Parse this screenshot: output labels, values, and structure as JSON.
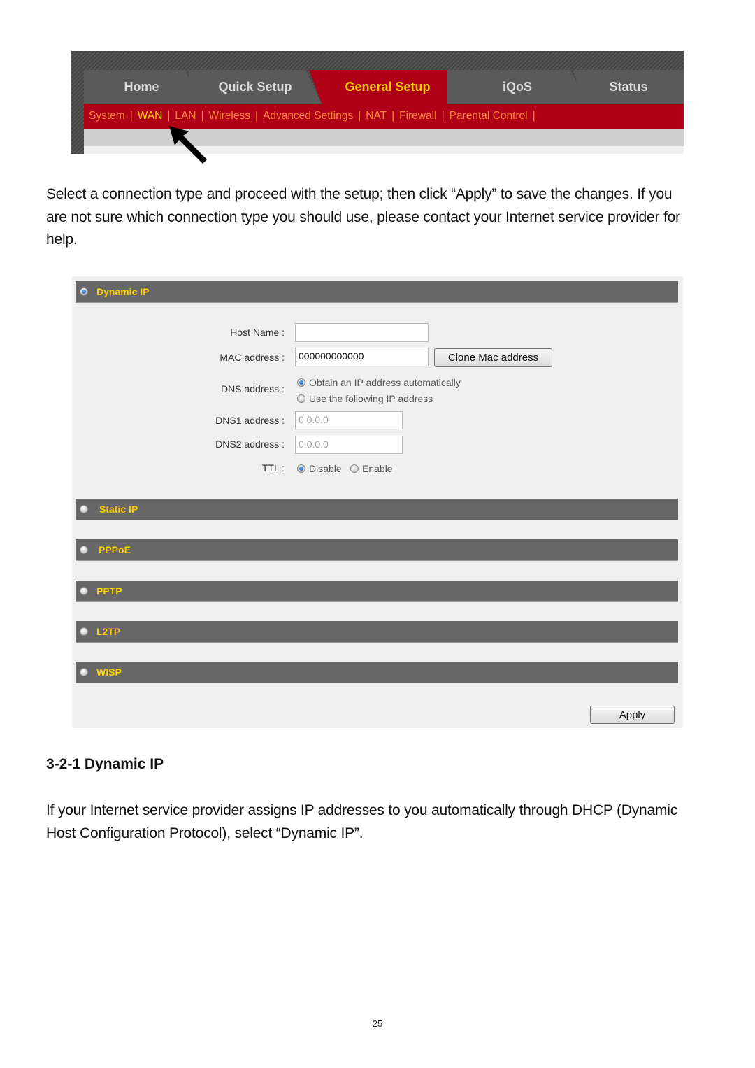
{
  "nav": {
    "tabs": [
      {
        "label": "Home",
        "active": false
      },
      {
        "label": "Quick Setup",
        "active": false
      },
      {
        "label": "General Setup",
        "active": true
      },
      {
        "label": "iQoS",
        "active": false
      },
      {
        "label": "Status",
        "active": false
      }
    ],
    "subnav": [
      {
        "label": "System",
        "active": false
      },
      {
        "label": "WAN",
        "active": true
      },
      {
        "label": "LAN",
        "active": false
      },
      {
        "label": "Wireless",
        "active": false
      },
      {
        "label": "Advanced Settings",
        "active": false
      },
      {
        "label": "NAT",
        "active": false
      },
      {
        "label": "Firewall",
        "active": false
      },
      {
        "label": "Parental Control",
        "active": false
      }
    ],
    "separator": "|",
    "annotation": "arrow pointing to WAN"
  },
  "intro_text": "Select a connection type and proceed with the setup; then click “Apply” to save the changes. If you are not sure which connection type you should use, please contact your Internet service provider for help.",
  "wan_panel": {
    "sections": [
      {
        "label": "Dynamic IP",
        "selected": true
      },
      {
        "label": "Static IP",
        "selected": false
      },
      {
        "label": "PPPoE",
        "selected": false
      },
      {
        "label": "PPTP",
        "selected": false
      },
      {
        "label": "L2TP",
        "selected": false
      },
      {
        "label": "WISP",
        "selected": false
      }
    ],
    "form": {
      "host_name_label": "Host Name :",
      "host_name_value": "",
      "mac_label": "MAC address :",
      "mac_value": "000000000000",
      "clone_button": "Clone Mac address",
      "dns_label": "DNS address :",
      "dns_options": [
        {
          "label": "Obtain an IP address automatically",
          "selected": true
        },
        {
          "label": "Use the following IP address",
          "selected": false
        }
      ],
      "dns1_label": "DNS1 address :",
      "dns1_value": "0.0.0.0",
      "dns2_label": "DNS2 address :",
      "dns2_value": "0.0.0.0",
      "ttl_label": "TTL :",
      "ttl_options": [
        {
          "label": "Disable",
          "selected": true
        },
        {
          "label": "Enable",
          "selected": false
        }
      ]
    },
    "apply_button": "Apply"
  },
  "section_heading": "3-2-1 Dynamic IP",
  "body_text": "If your Internet service provider assigns IP addresses to you automatically through DHCP (Dynamic Host Configuration Protocol), select “Dynamic IP”.",
  "page_number": "25",
  "colors": {
    "nav_red": "#b00018",
    "active_tab_text": "#ffcc00",
    "subnav_text": "#ff8a3a",
    "section_bar": "#676767",
    "section_label": "#ffcc00"
  }
}
